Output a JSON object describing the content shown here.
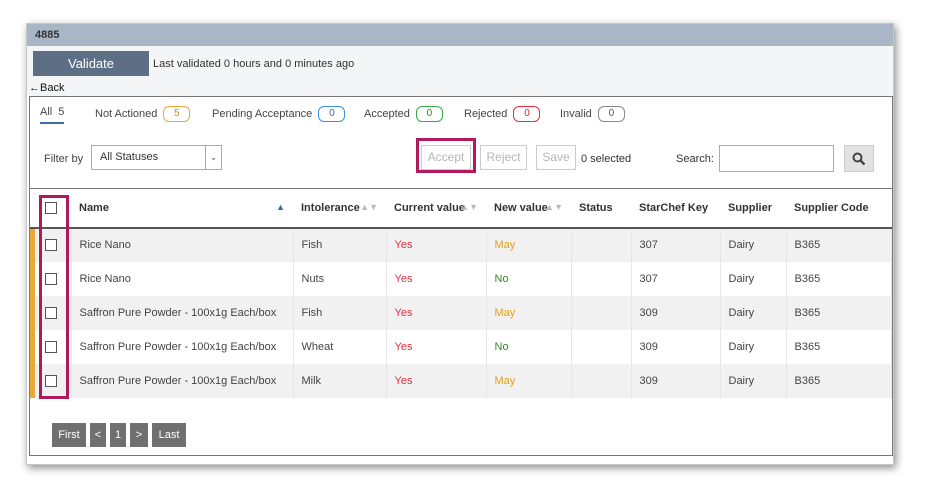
{
  "window": {
    "title": "4885"
  },
  "top": {
    "validate_label": "Validate",
    "last_validated": "Last validated 0 hours and 0 minutes ago",
    "back_label": "Back"
  },
  "tabs": [
    {
      "label": "All",
      "count": "5"
    },
    {
      "label": "Not Actioned",
      "count": "5",
      "color": "#e8a93a"
    },
    {
      "label": "Pending Acceptance",
      "count": "0",
      "color": "#3b8ee0"
    },
    {
      "label": "Accepted",
      "count": "0",
      "color": "#3aa845"
    },
    {
      "label": "Rejected",
      "count": "0",
      "color": "#e0313b"
    },
    {
      "label": "Invalid",
      "count": "0",
      "color": "#888888"
    }
  ],
  "toolbar": {
    "filter_label": "Filter by",
    "filter_value": "All Statuses",
    "accept_label": "Accept",
    "reject_label": "Reject",
    "save_label": "Save",
    "selected_count": "0 selected",
    "search_label": "Search:",
    "search_value": "",
    "search_icon": "search-icon"
  },
  "table": {
    "headers": [
      "Name",
      "Intolerance",
      "Current value",
      "New value",
      "Status",
      "StarChef Key",
      "Supplier",
      "Supplier Code"
    ],
    "rows": [
      {
        "name": "Rice Nano",
        "intolerance": "Fish",
        "current": "Yes",
        "new": "May",
        "status": "",
        "key": "307",
        "supplier": "Dairy",
        "code": "B365"
      },
      {
        "name": "Rice Nano",
        "intolerance": "Nuts",
        "current": "Yes",
        "new": "No",
        "status": "",
        "key": "307",
        "supplier": "Dairy",
        "code": "B365"
      },
      {
        "name": "Saffron Pure Powder - 100x1g Each/box",
        "intolerance": "Fish",
        "current": "Yes",
        "new": "May",
        "status": "",
        "key": "309",
        "supplier": "Dairy",
        "code": "B365"
      },
      {
        "name": "Saffron Pure Powder - 100x1g Each/box",
        "intolerance": "Wheat",
        "current": "Yes",
        "new": "No",
        "status": "",
        "key": "309",
        "supplier": "Dairy",
        "code": "B365"
      },
      {
        "name": "Saffron Pure Powder - 100x1g Each/box",
        "intolerance": "Milk",
        "current": "Yes",
        "new": "May",
        "status": "",
        "key": "309",
        "supplier": "Dairy",
        "code": "B365"
      }
    ]
  },
  "pager": {
    "first": "First",
    "prev": "<",
    "page": "1",
    "next": ">",
    "last": "Last"
  },
  "colors": {
    "yes": "#e0313b",
    "may": "#e0a020",
    "no": "#2e8b1f",
    "accent": "#b0195a"
  }
}
